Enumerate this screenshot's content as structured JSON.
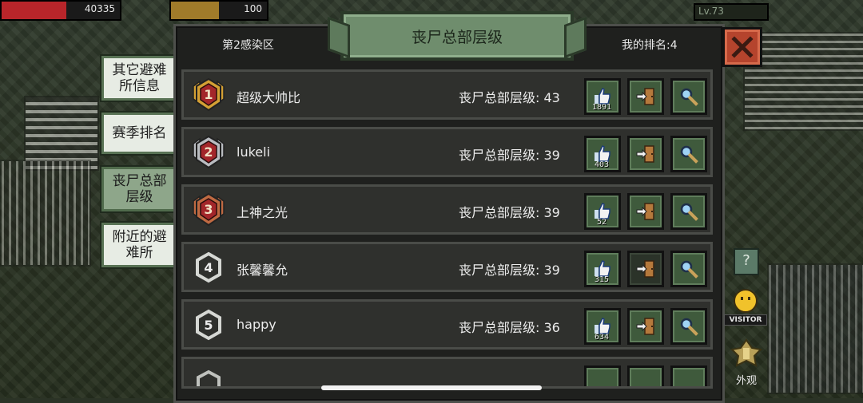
{
  "hud": {
    "hp_value": "40335",
    "food_value": "100",
    "level": "Lv.73",
    "hp_fraction": 0.55,
    "food_fraction": 0.5
  },
  "tabs": [
    {
      "label": "其它避难\n所信息",
      "active": false
    },
    {
      "label": "赛季排名",
      "active": false
    },
    {
      "label": "丧尸总部\n层级",
      "active": true
    },
    {
      "label": "附近的避\n难所",
      "active": false
    }
  ],
  "panel": {
    "title": "丧尸总部层级",
    "zone": "第2感染区",
    "my_rank": "我的排名:4"
  },
  "rows": [
    {
      "rank": "1",
      "name": "超级大帅比",
      "level_text": "丧尸总部层级: 43",
      "likes": "1891",
      "visit_dim": false
    },
    {
      "rank": "2",
      "name": "lukeli",
      "level_text": "丧尸总部层级: 39",
      "likes": "403",
      "visit_dim": false
    },
    {
      "rank": "3",
      "name": "上神之光",
      "level_text": "丧尸总部层级: 39",
      "likes": "52",
      "visit_dim": false
    },
    {
      "rank": "4",
      "name": "张馨馨允",
      "level_text": "丧尸总部层级: 39",
      "likes": "315",
      "visit_dim": true
    },
    {
      "rank": "5",
      "name": "happy",
      "level_text": "丧尸总部层级: 36",
      "likes": "634",
      "visit_dim": false
    }
  ],
  "side": {
    "help_label": "?",
    "visitor_label": "VISITOR",
    "appearance_label": "外观"
  },
  "colors": {
    "gold": "#d4a034",
    "silver": "#b9bcc0",
    "bronze": "#c06a42",
    "accent_green": "#6f8d6d",
    "close_red": "#b5442d"
  },
  "icons": {
    "like": "thumbs-up-icon",
    "visit": "enter-door-icon",
    "search": "magnifier-icon",
    "close": "close-icon"
  }
}
